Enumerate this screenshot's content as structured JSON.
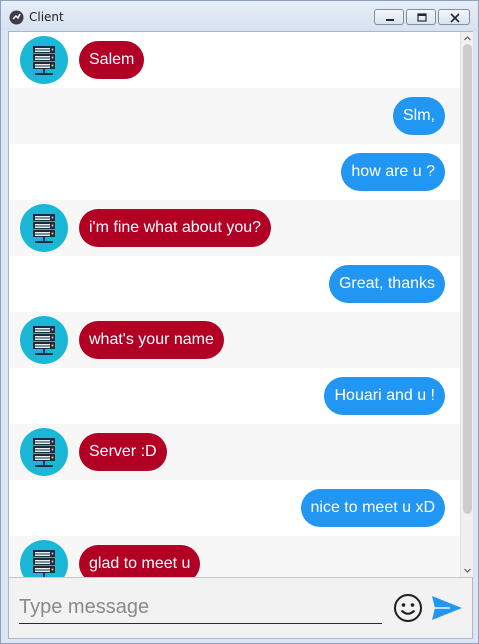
{
  "window": {
    "title": "Client"
  },
  "messages": [
    {
      "side": "in",
      "text": "Salem"
    },
    {
      "side": "out",
      "text": "Slm,"
    },
    {
      "side": "out",
      "text": "how are u ?"
    },
    {
      "side": "in",
      "text": "i'm fine what about you?"
    },
    {
      "side": "out",
      "text": "Great, thanks"
    },
    {
      "side": "in",
      "text": "what's your name"
    },
    {
      "side": "out",
      "text": "Houari and u !"
    },
    {
      "side": "in",
      "text": "Server :D"
    },
    {
      "side": "out",
      "text": "nice to meet u xD"
    },
    {
      "side": "in",
      "text": "glad to meet u"
    }
  ],
  "composer": {
    "placeholder": "Type message"
  },
  "icons": {
    "avatar": "server-icon",
    "emoji": "smiley-icon",
    "send": "send-icon"
  },
  "colors": {
    "incoming": "#b20024",
    "outgoing": "#2196f3",
    "avatar": "#1ab8d6"
  }
}
